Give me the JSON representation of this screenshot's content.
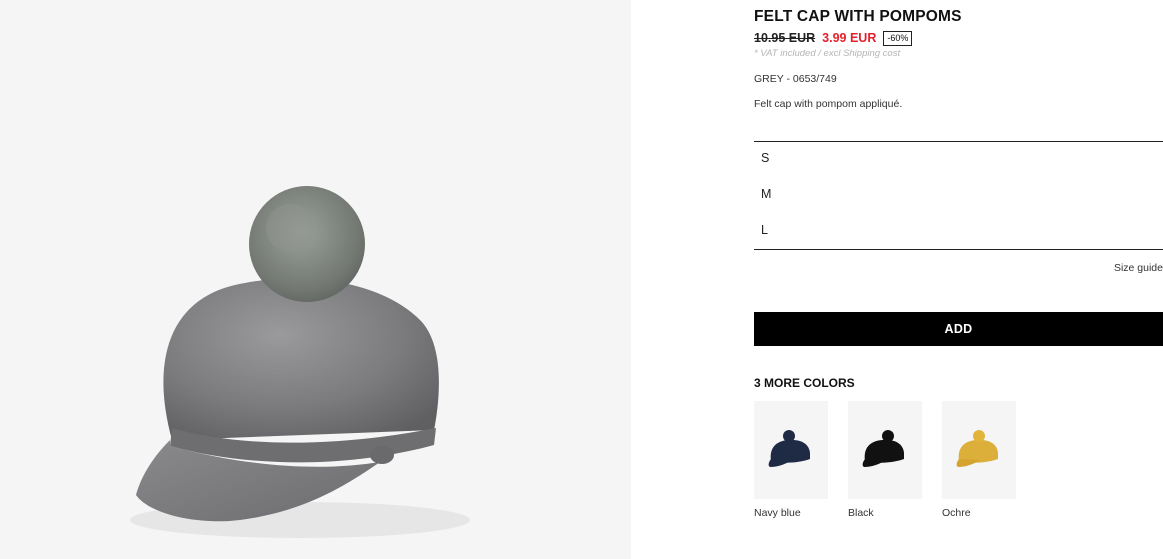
{
  "product": {
    "title": "FELT CAP WITH POMPOMS",
    "old_price": "10.95 EUR",
    "new_price": "3.99 EUR",
    "discount": "-60%",
    "vat_note": "* VAT included / excl Shipping cost",
    "color_ref": "GREY - 0653/749",
    "description": "Felt cap with pompom appliqué.",
    "image_icon": "grey-felt-cap-image"
  },
  "sizes": [
    "S",
    "M",
    "L"
  ],
  "size_guide_label": "Size guide",
  "add_label": "ADD",
  "more_colors": {
    "heading": "3 MORE COLORS",
    "items": [
      {
        "name": "Navy blue",
        "color": "#1f2a44"
      },
      {
        "name": "Black",
        "color": "#111111"
      },
      {
        "name": "Ochre",
        "color": "#dcae3a"
      }
    ]
  },
  "colors": {
    "sale": "#e5202b",
    "button_bg": "#000000",
    "image_bg": "#f5f5f5"
  }
}
